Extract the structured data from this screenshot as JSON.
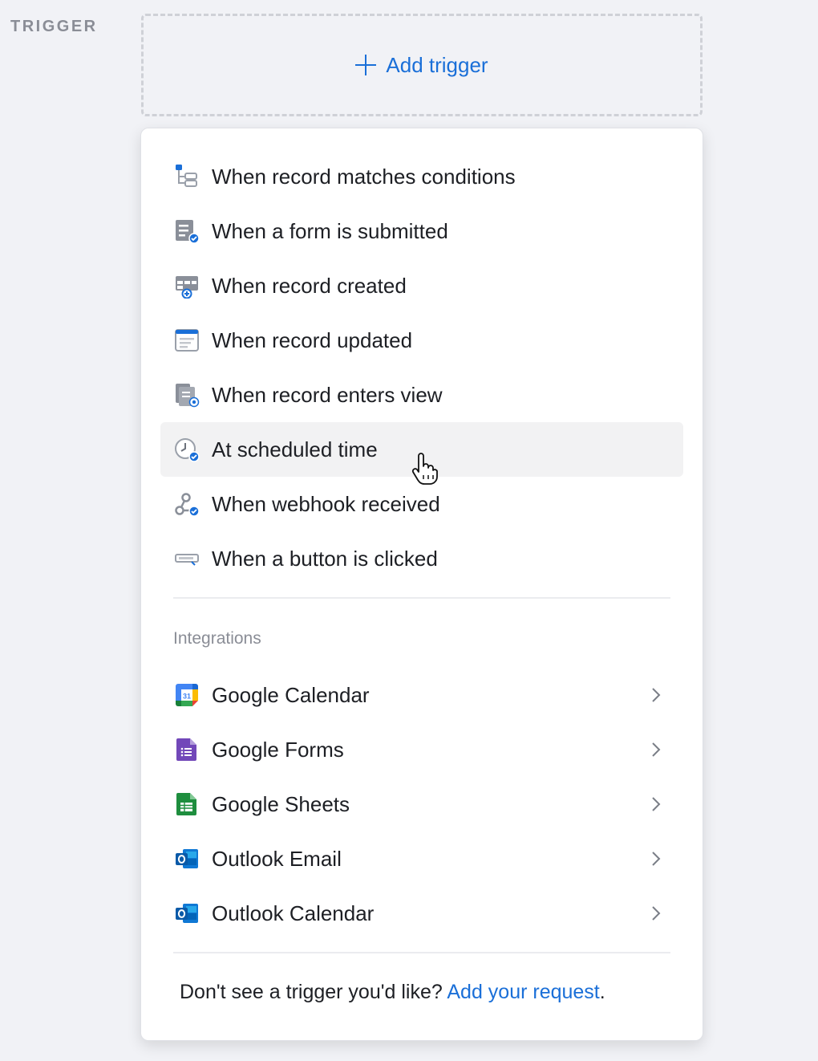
{
  "section_label": "TRIGGER",
  "add_trigger": {
    "label": "Add trigger",
    "icon": "plus-icon"
  },
  "triggers": [
    {
      "label": "When record matches conditions",
      "icon": "conditions-icon"
    },
    {
      "label": "When a form is submitted",
      "icon": "form-submitted-icon"
    },
    {
      "label": "When record created",
      "icon": "record-created-icon"
    },
    {
      "label": "When record updated",
      "icon": "record-updated-icon"
    },
    {
      "label": "When record enters view",
      "icon": "record-enters-view-icon"
    },
    {
      "label": "At scheduled time",
      "icon": "clock-icon",
      "hovered": true
    },
    {
      "label": "When webhook received",
      "icon": "webhook-icon"
    },
    {
      "label": "When a button is clicked",
      "icon": "button-icon"
    }
  ],
  "integrations_title": "Integrations",
  "integrations": [
    {
      "label": "Google Calendar",
      "icon": "google-calendar-icon"
    },
    {
      "label": "Google Forms",
      "icon": "google-forms-icon"
    },
    {
      "label": "Google Sheets",
      "icon": "google-sheets-icon"
    },
    {
      "label": "Outlook Email",
      "icon": "outlook-email-icon"
    },
    {
      "label": "Outlook Calendar",
      "icon": "outlook-calendar-icon"
    }
  ],
  "footer": {
    "text": "Don't see a trigger you'd like? ",
    "link": "Add your request",
    "end": "."
  },
  "colors": {
    "accent": "#1a6fd8",
    "hover": "#f2f2f3",
    "background": "#f1f2f6"
  }
}
